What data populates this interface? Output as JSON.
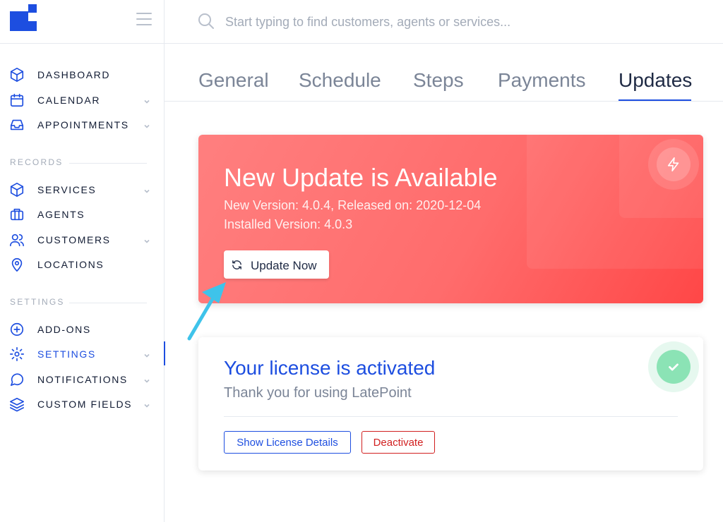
{
  "search": {
    "placeholder": "Start typing to find customers, agents or services..."
  },
  "sidebar": {
    "main_items": [
      {
        "label": "DASHBOARD",
        "icon": "cube-icon"
      },
      {
        "label": "CALENDAR",
        "icon": "calendar-icon"
      },
      {
        "label": "APPOINTMENTS",
        "icon": "inbox-icon"
      }
    ],
    "records_heading": "RECORDS",
    "records_items": [
      {
        "label": "SERVICES",
        "icon": "cube-icon"
      },
      {
        "label": "AGENTS",
        "icon": "briefcase-icon"
      },
      {
        "label": "CUSTOMERS",
        "icon": "users-icon"
      },
      {
        "label": "LOCATIONS",
        "icon": "map-pin-icon"
      }
    ],
    "settings_heading": "SETTINGS",
    "settings_items": [
      {
        "label": "ADD-ONS",
        "icon": "plus-circle-icon"
      },
      {
        "label": "SETTINGS",
        "icon": "gear-icon"
      },
      {
        "label": "NOTIFICATIONS",
        "icon": "message-circle-icon"
      },
      {
        "label": "CUSTOM FIELDS",
        "icon": "layers-icon"
      }
    ],
    "active": "SETTINGS"
  },
  "tabs": {
    "items": [
      "General",
      "Schedule",
      "Steps",
      "Payments",
      "Updates"
    ],
    "active": "Updates"
  },
  "update_card": {
    "title": "New Update is Available",
    "new_version": "New Version: 4.0.4, Released on: 2020-12-04",
    "installed_version": "Installed Version: 4.0.3",
    "button_label": "Update Now",
    "icon": "lightning-icon",
    "accent": "#ff5a5a"
  },
  "license_card": {
    "title": "Your license is activated",
    "subtitle": "Thank you for using LatePoint",
    "details_button": "Show License Details",
    "deactivate_button": "Deactivate",
    "icon": "check-icon"
  },
  "colors": {
    "brand": "#1d4ee0",
    "danger": "#d11f1f",
    "success": "#8be3b5",
    "annotation_arrow": "#3ec3ea"
  }
}
